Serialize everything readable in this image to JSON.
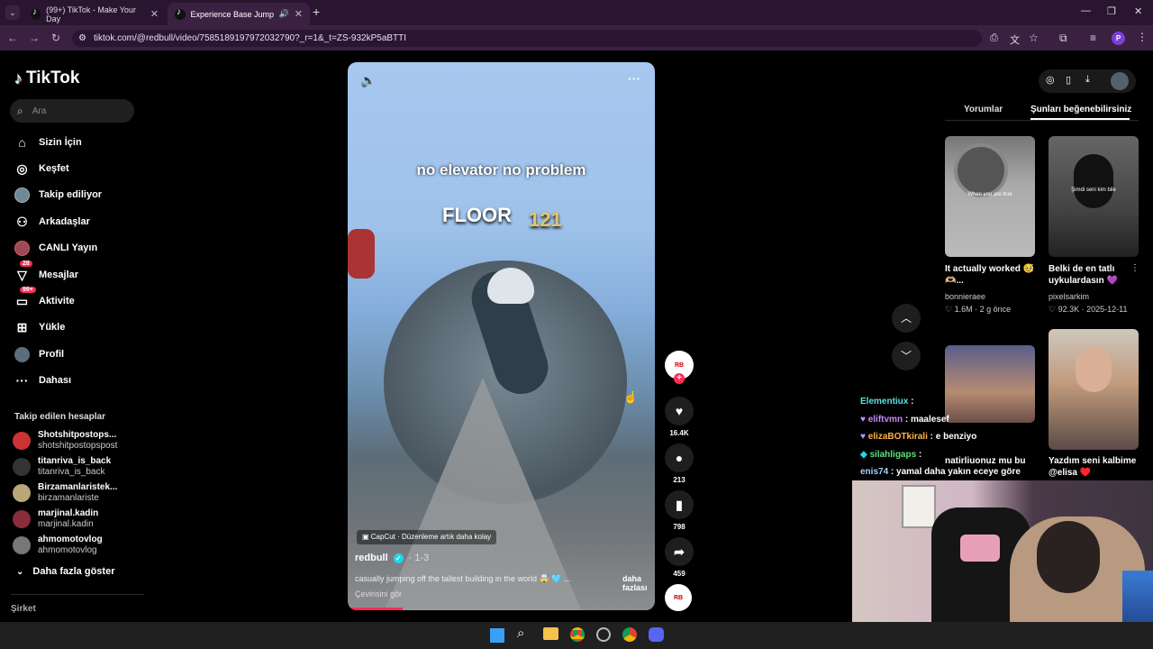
{
  "browser": {
    "tabs": [
      {
        "title": "(99+) TikTok - Make Your Day",
        "active": false
      },
      {
        "title": "Experience Base Jumping fr",
        "active": true
      }
    ],
    "url": "tiktok.com/@redbull/video/7585189197972032790?_r=1&_t=ZS-932kP5aBTTI",
    "profile_letter": "P"
  },
  "sidebar": {
    "logo": "TikTok",
    "search_placeholder": "Ara",
    "items": [
      {
        "label": "Sizin İçin",
        "icon": "home-icon"
      },
      {
        "label": "Keşfet",
        "icon": "compass-icon"
      },
      {
        "label": "Takip ediliyor",
        "icon": "following-avatar-icon"
      },
      {
        "label": "Arkadaşlar",
        "icon": "friends-icon"
      },
      {
        "label": "CANLI Yayın",
        "icon": "live-icon"
      },
      {
        "label": "Mesajlar",
        "icon": "messages-icon",
        "badge": "28"
      },
      {
        "label": "Aktivite",
        "icon": "activity-icon",
        "badge": "99+"
      },
      {
        "label": "Yükle",
        "icon": "upload-icon"
      },
      {
        "label": "Profil",
        "icon": "profile-avatar-icon"
      },
      {
        "label": "Dahası",
        "icon": "more-dots-icon"
      }
    ],
    "following_header": "Takip edilen hesaplar",
    "following": [
      {
        "name": "Shotshitpostops...",
        "handle": "shotshitpostopspost"
      },
      {
        "name": "titanriva_is_back",
        "handle": "titanriva_is_back"
      },
      {
        "name": "Birzamanlaristek...",
        "handle": "birzamanlariste"
      },
      {
        "name": "marjinal.kadin",
        "handle": "marjinal.kadin"
      },
      {
        "name": "ahmomotovlog",
        "handle": "ahmomotovlog"
      }
    ],
    "show_more": "Daha fazla göster",
    "company": "Şirket"
  },
  "video": {
    "overlay_text": "no elevator no problem",
    "floor_label": "FLOOR",
    "floor_number": "121",
    "capcut_label": "CapCut · Düzenleme artık daha kolay",
    "username": "redbull",
    "date": "· 1-3",
    "description": "casually jumping off the tallest building in the world 🤯 🩵 ...",
    "more": "daha fazlası",
    "translate": "Çevirisini gör",
    "progress": 0.18
  },
  "actions": {
    "likes": "16.4K",
    "comments": "213",
    "saves": "798",
    "shares": "459"
  },
  "right_panel": {
    "tab_comments": "Yorumlar",
    "tab_recommended": "Şunları beğenebilirsiniz",
    "cards": [
      {
        "title": "It actually worked 🥹🫶🏼...",
        "author": "bonnieraee",
        "likes": "1.6M",
        "date": "2 g önce",
        "thumb_text": "When you are true"
      },
      {
        "title": "Belki de en tatlı uykulardasın 💜",
        "author": "pixelsarkim",
        "likes": "92.3K",
        "date": "2025-12-11",
        "thumb_text": "Şimdi seni kim bile"
      },
      {
        "title": "natirliuonuz mu bu",
        "author": "",
        "likes": "",
        "date": ""
      },
      {
        "title": "Yazdım seni kalbime @elisa ♥️",
        "author": "",
        "likes": "",
        "date": ""
      }
    ]
  },
  "chat": [
    {
      "user": "Elementiux",
      "msg": "",
      "color": "#5be0e0"
    },
    {
      "user": "eliftvmn",
      "msg": "maalesef",
      "color": "#c48cff"
    },
    {
      "user": "elizaBOTkirali",
      "msg": "e benziyo",
      "color": "#ffb347"
    },
    {
      "user": "silahligaps",
      "msg": "",
      "color": "#5be07a"
    },
    {
      "user": "enis74",
      "msg": "yamal daha yakın eceye göre",
      "color": "#9fd0ff"
    }
  ]
}
